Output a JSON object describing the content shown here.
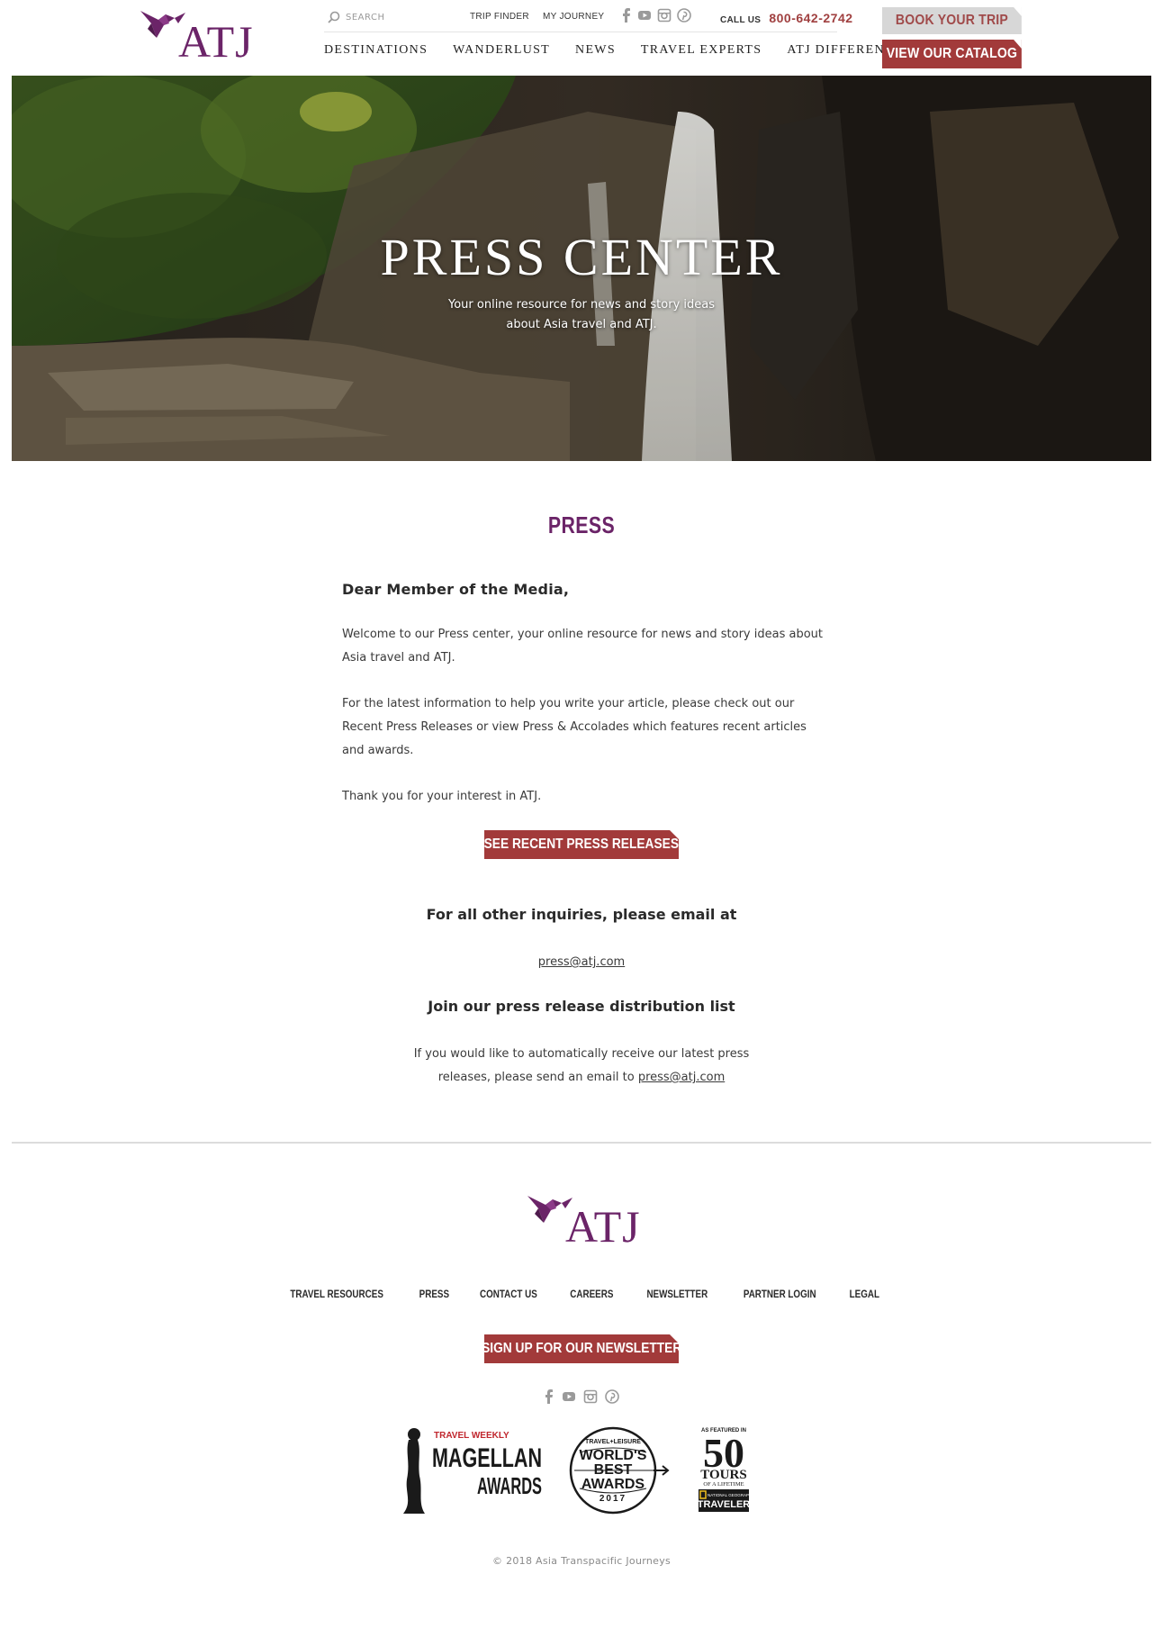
{
  "header": {
    "logo_text": "ATJ",
    "search_placeholder": "SEARCH",
    "trip_finder": "TRIP FINDER",
    "my_journey": "MY JOURNEY",
    "call_label": "CALL US",
    "phone": "800-642-2742",
    "book_button": "BOOK YOUR TRIP",
    "catalog_button": "VIEW OUR CATALOG",
    "nav": [
      "DESTINATIONS",
      "WANDERLUST",
      "NEWS",
      "TRAVEL EXPERTS",
      "ATJ DIFFERENCE"
    ],
    "social_icons": [
      "facebook-icon",
      "youtube-icon",
      "instagram-icon",
      "pinterest-icon"
    ]
  },
  "hero": {
    "title": "PRESS CENTER",
    "subtitle_line1": "Your online resource for news and story ideas",
    "subtitle_line2": "about Asia travel and ATJ."
  },
  "content": {
    "section_title": "PRESS",
    "greeting": "Dear Member of the Media,",
    "paragraph1": "Welcome to our Press center, your online resource for news and story ideas about Asia travel and ATJ.",
    "paragraph2": "For the latest information to help you write your article, please check out our Recent Press Releases or view Press & Accolades which features recent articles and awards.",
    "paragraph3": "Thank you for your interest in ATJ.",
    "press_button": "SEE RECENT PRESS RELEASES",
    "inquiries_heading": "For all other inquiries, please email at",
    "email": "press@atj.com",
    "join_heading": "Join our press release distribution list",
    "join_line1": "If you would like to automatically receive our latest press",
    "join_line2_prefix": "releases, please send an email to ",
    "join_email": "press@atj.com"
  },
  "footer": {
    "logo_text": "ATJ",
    "nav": [
      "TRAVEL RESOURCES",
      "PRESS",
      "CONTACT US",
      "CAREERS",
      "NEWSLETTER",
      "PARTNER LOGIN",
      "LEGAL"
    ],
    "newsletter_button": "SIGN UP FOR OUR NEWSLETTER",
    "social_icons": [
      "facebook-icon",
      "youtube-icon",
      "instagram-icon",
      "pinterest-icon"
    ],
    "awards": {
      "magellan": {
        "top": "TRAVEL WEEKLY",
        "line1": "MAGELLAN",
        "line2": "AWARDS"
      },
      "worlds_best": {
        "top": "TRAVEL+LEISURE",
        "line1": "WORLD'S",
        "line2": "BEST",
        "line3": "AWARDS",
        "year": "2017"
      },
      "fifty_tours": {
        "top": "AS FEATURED IN",
        "number": "50",
        "line1": "TOURS",
        "line2": "OF A LIFETIME",
        "badge_top": "NATIONAL GEOGRAPHIC",
        "badge": "TRAVELER"
      }
    },
    "copyright": "© 2018 Asia Transpacific Journeys"
  },
  "colors": {
    "brand_purple": "#6b2468",
    "brand_red": "#a23a3a",
    "book_button_bg": "#d7d7d7"
  }
}
